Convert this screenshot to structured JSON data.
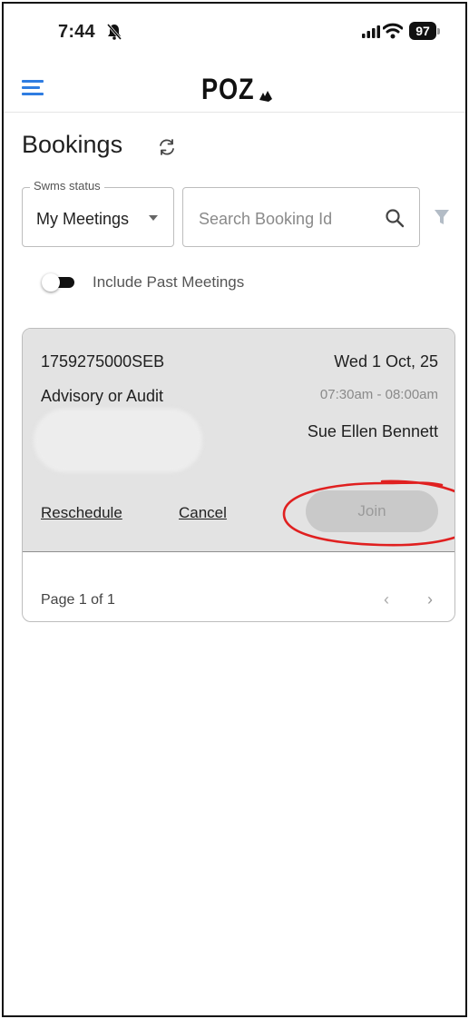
{
  "status_bar": {
    "time": "7:44",
    "battery": "97"
  },
  "header": {
    "logo": "POZ"
  },
  "page": {
    "title": "Bookings"
  },
  "filters": {
    "status_legend": "Swms status",
    "status_value": "My Meetings",
    "search_placeholder": "Search Booking Id",
    "include_past_label": "Include Past Meetings",
    "include_past_enabled": false
  },
  "booking": {
    "id": "1759275000SEB",
    "date": "Wed 1 Oct, 25",
    "type": "Advisory or Audit",
    "time": "07:30am - 08:00am",
    "person": "Sue Ellen Bennett",
    "reschedule_label": "Reschedule",
    "cancel_label": "Cancel",
    "join_label": "Join"
  },
  "pagination": {
    "label": "Page 1 of 1",
    "prev": "‹",
    "next": "›"
  },
  "colors": {
    "accent": "#2f7de1",
    "highlight": "#e02020"
  }
}
